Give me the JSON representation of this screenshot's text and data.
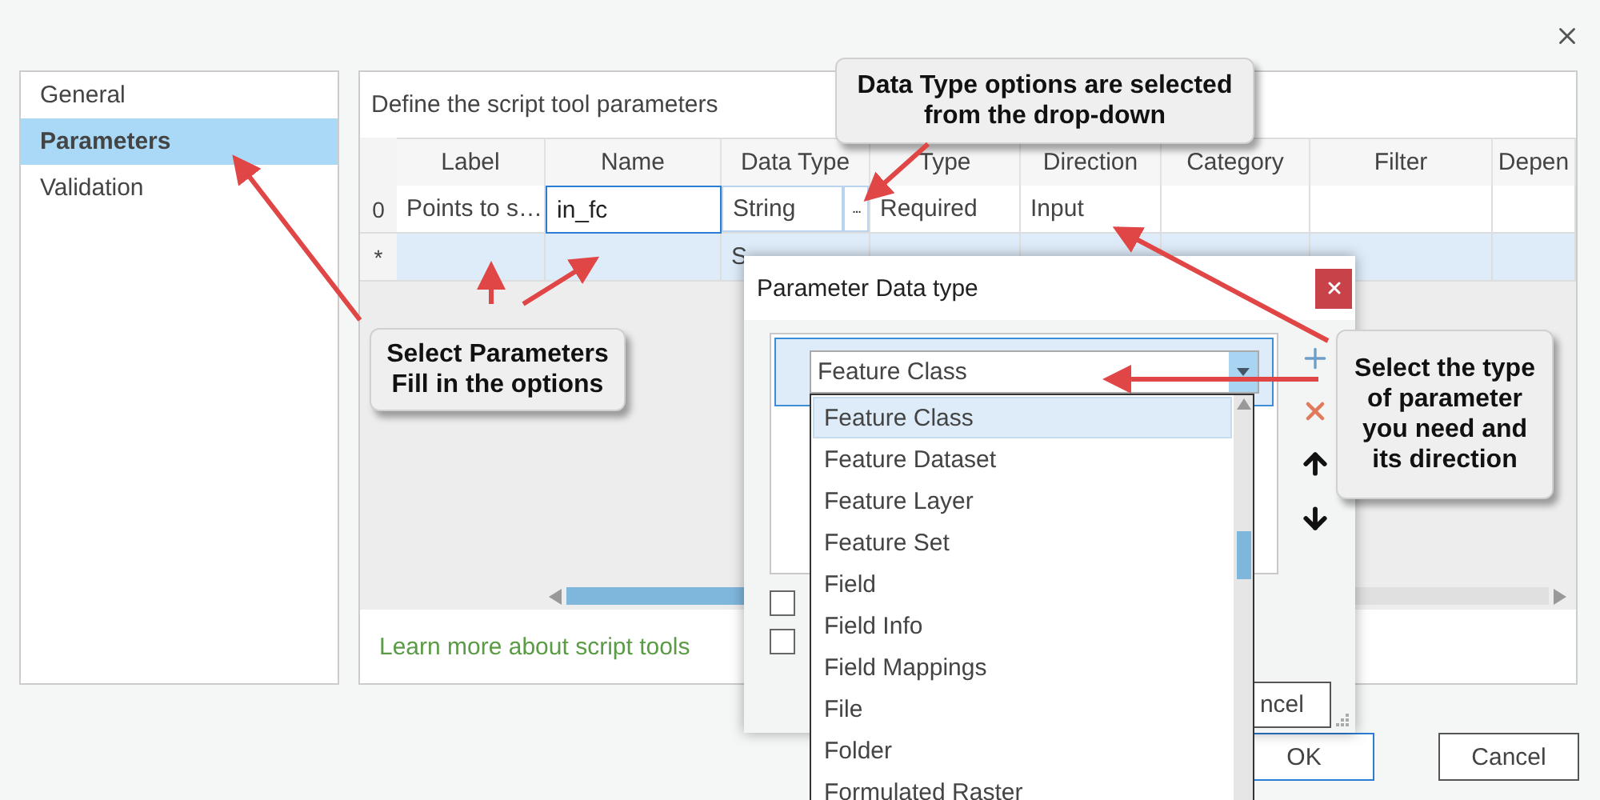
{
  "sidebar": {
    "items": [
      {
        "label": "General",
        "selected": false
      },
      {
        "label": "Parameters",
        "selected": true
      },
      {
        "label": "Validation",
        "selected": false
      }
    ]
  },
  "main": {
    "heading": "Define the script tool parameters",
    "table": {
      "columns": [
        "Label",
        "Name",
        "Data Type",
        "Type",
        "Direction",
        "Category",
        "Filter",
        "Depen"
      ],
      "rows": [
        {
          "marker": "0",
          "label": "Points to s…",
          "name": "in_fc",
          "name_editing": true,
          "data_type": "String",
          "data_type_button": "...",
          "type": "Required",
          "direction": "Input",
          "selected": false
        },
        {
          "marker": "*",
          "data_type": "S",
          "name_editing": false,
          "selected": true
        }
      ]
    },
    "link": "Learn more about script tools"
  },
  "footer": {
    "buttons": [
      {
        "label": "OK",
        "default": true
      },
      {
        "label": "Cancel",
        "default": false
      }
    ]
  },
  "dialog": {
    "title": "Parameter Data type",
    "selected_type": "Feature Class",
    "options": [
      {
        "label": "Feature Class",
        "selected": true
      },
      {
        "label": "Feature Dataset",
        "selected": false
      },
      {
        "label": "Feature Layer",
        "selected": false
      },
      {
        "label": "Feature Set",
        "selected": false
      },
      {
        "label": "Field",
        "selected": false
      },
      {
        "label": "Field Info",
        "selected": false
      },
      {
        "label": "Field Mappings",
        "selected": false
      },
      {
        "label": "File",
        "selected": false
      },
      {
        "label": "Folder",
        "selected": false
      },
      {
        "label": "Formulated Raster",
        "selected": false
      }
    ],
    "checkboxes": [
      {
        "checked": false
      },
      {
        "checked": false
      }
    ],
    "cancel_button": "ncel"
  },
  "callouts": [
    {
      "lines": [
        "Data Type options are selected",
        "from the drop-down"
      ]
    },
    {
      "lines": [
        "Select Parameters",
        "Fill in the options"
      ]
    },
    {
      "lines": [
        "Select the type",
        "of parameter",
        "you need and",
        "its direction"
      ]
    }
  ]
}
